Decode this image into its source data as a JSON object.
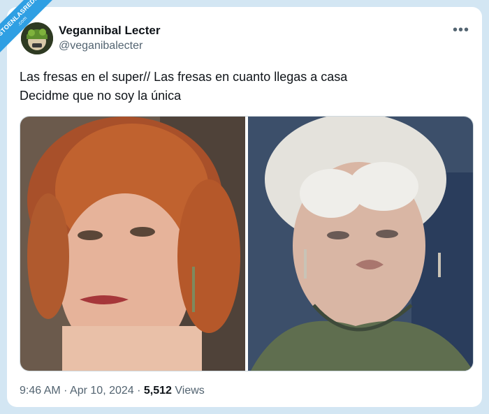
{
  "tweet": {
    "display_name": "Vegannibal Lecter",
    "handle": "@veganibalecter",
    "text_line1": "Las fresas en el super// Las fresas en cuanto llegas a casa",
    "text_line2": "Decidme que no soy la única",
    "time": "9:46 AM",
    "date": "Apr 10, 2024",
    "views_count": "5,512",
    "views_label": "Views",
    "more_icon": "more-icon"
  },
  "watermark": {
    "text": "VISTOENLASREDES",
    "suffix": ".com"
  },
  "colors": {
    "background": "#d3e6f3",
    "card": "#ffffff",
    "secondary_text": "#536471",
    "primary_text": "#0f1419",
    "ribbon": "#2f9fe3"
  }
}
